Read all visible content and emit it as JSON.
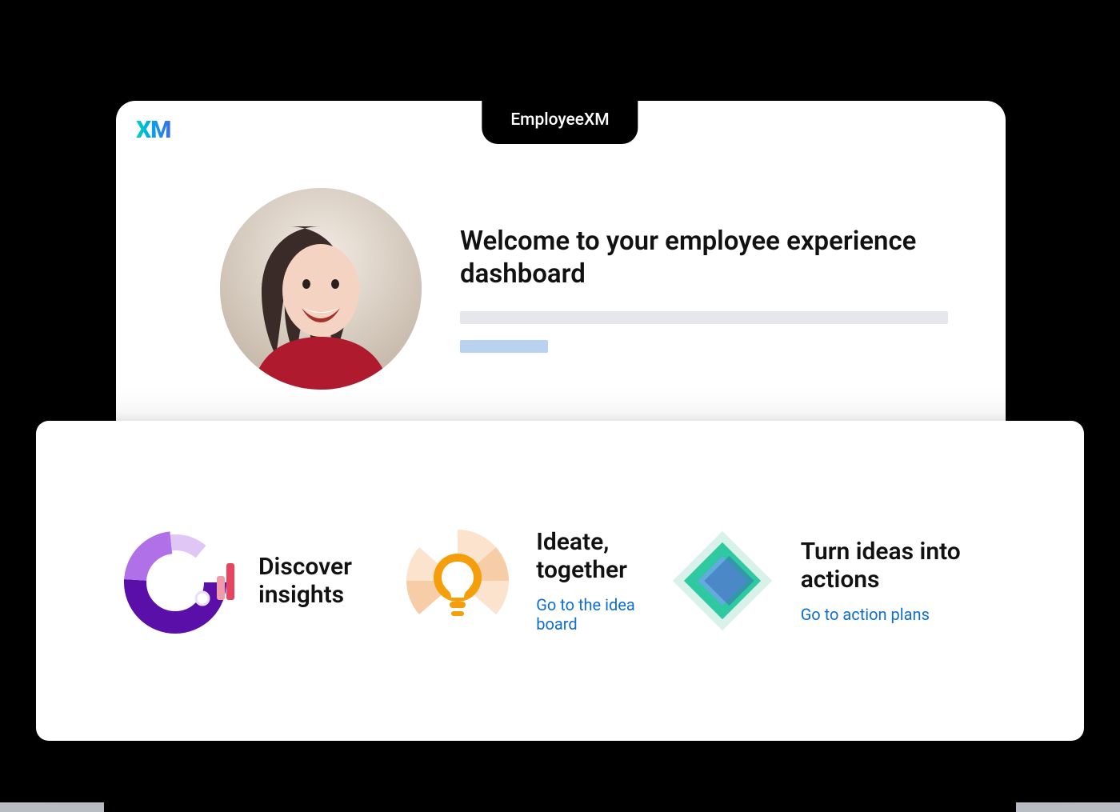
{
  "tab_label": "EmployeeXM",
  "logo_text": "XM",
  "hero": {
    "title": "Welcome to your employee experience dashboard"
  },
  "cards": [
    {
      "title": "Discover insights",
      "link_label": null,
      "icon": "chart-donut-icon"
    },
    {
      "title": "Ideate, together",
      "link_label": "Go to the idea board",
      "icon": "lightbulb-icon"
    },
    {
      "title": "Turn ideas into actions",
      "link_label": "Go to action plans",
      "icon": "diamond-layers-icon"
    }
  ],
  "colors": {
    "link": "#0d6ed1",
    "skeleton_light": "#e5e7ea",
    "skeleton_blue": "#b8d2f0"
  }
}
